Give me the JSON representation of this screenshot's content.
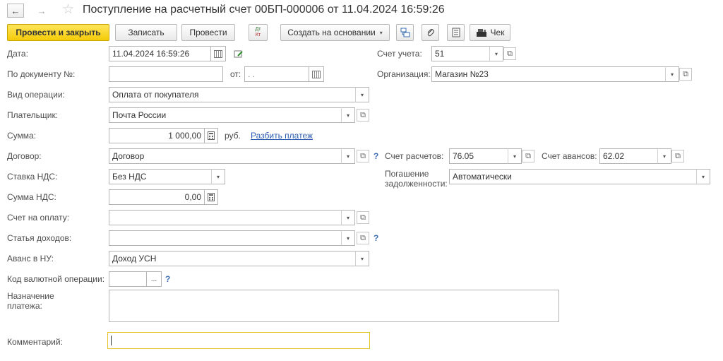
{
  "window": {
    "title": "Поступление на расчетный счет 00БП-000006 от 11.04.2024 16:59:26",
    "back_glyph": "←",
    "forward_glyph": "→",
    "favorite_glyph": "☆"
  },
  "toolbar": {
    "post_close": "Провести и закрыть",
    "save": "Записать",
    "post": "Провести",
    "dt_kt_top": "Дт",
    "dt_kt_bottom": "Кт",
    "create_based": "Создать на основании",
    "check": "Чек"
  },
  "form": {
    "date": {
      "label": "Дата:",
      "value": "11.04.2024 16:59:26"
    },
    "doc_no": {
      "label": "По документу №:",
      "value": "",
      "from_label": "от:",
      "from_value": " .  . "
    },
    "operation": {
      "label": "Вид операции:",
      "value": "Оплата от покупателя"
    },
    "payer": {
      "label": "Плательщик:",
      "value": "Почта России"
    },
    "amount": {
      "label": "Сумма:",
      "value": "1 000,00",
      "currency": "руб.",
      "split_link": "Разбить платеж"
    },
    "contract": {
      "label": "Договор:",
      "value": "Договор",
      "help": "?"
    },
    "vat_rate": {
      "label": "Ставка НДС:",
      "value": "Без НДС"
    },
    "vat_amount": {
      "label": "Сумма НДС:",
      "value": "0,00"
    },
    "invoice": {
      "label": "Счет на оплату:",
      "value": ""
    },
    "income_item": {
      "label": "Статья доходов:",
      "value": "",
      "help": "?"
    },
    "advance_nu": {
      "label": "Аванс в НУ:",
      "value": "Доход УСН"
    },
    "currency_code": {
      "label": "Код валютной операции:",
      "value": "",
      "help": "?"
    },
    "purpose": {
      "label_line1": "Назначение",
      "label_line2": "платежа:",
      "value": ""
    },
    "comment": {
      "label": "Комментарий:",
      "value": ""
    },
    "account": {
      "label": "Счет учета:",
      "value": "51"
    },
    "organization": {
      "label": "Организация:",
      "value": "Магазин №23"
    },
    "settlement_account": {
      "label": "Счет расчетов:",
      "value": "76.05"
    },
    "advance_account": {
      "label": "Счет авансов:",
      "value": "62.02"
    },
    "debt_repayment": {
      "label_line1": "Погашение",
      "label_line2": "задолженности:",
      "value": "Автоматически"
    }
  },
  "glyphs": {
    "dropdown": "▾",
    "open": "⧉",
    "ellipsis": "..."
  }
}
